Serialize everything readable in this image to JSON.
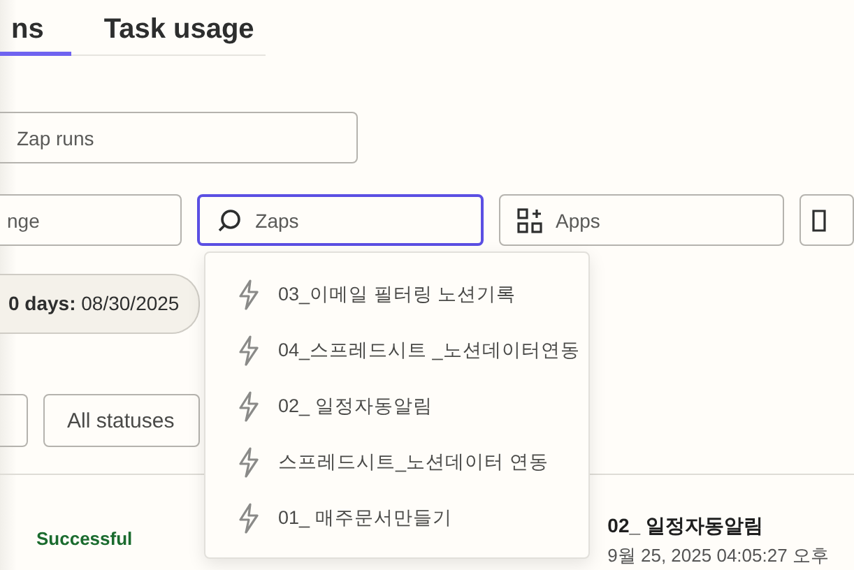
{
  "tabs": [
    {
      "label": "ns",
      "selected": true
    },
    {
      "label": "Task usage",
      "selected": false
    }
  ],
  "search": {
    "placeholder": "Zap runs"
  },
  "filters": [
    {
      "kind": "text",
      "placeholder": "nge",
      "focused": false
    },
    {
      "kind": "zaps",
      "placeholder": "Zaps",
      "focused": true
    },
    {
      "kind": "apps",
      "placeholder": "Apps",
      "focused": false
    },
    {
      "kind": "other",
      "focused": false
    }
  ],
  "date_chip": {
    "text": "**0 days:** 08/30/2025"
  },
  "zap_dropdown": {
    "items": [
      "03_이메일 필터링 노션기록",
      "04_스프레드시트 _노션데이터연동",
      "02_ 일정자동알림",
      "스프레드시트_노션데이터 연동",
      "01_ 매주문서만들기"
    ]
  },
  "status_filter": {
    "value": "All statuses"
  },
  "runs": [
    {
      "status": "Successful",
      "title": "02_ 일정자동알림",
      "time": "9월 25, 2025 04:05:27 오후"
    }
  ]
}
